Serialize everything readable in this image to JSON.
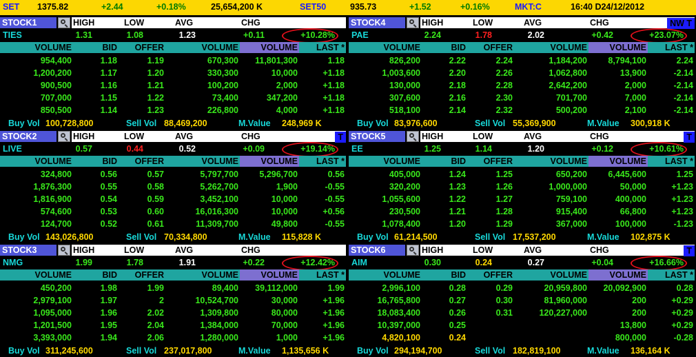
{
  "market_bar": {
    "set_label": "SET",
    "set_index": "1375.82",
    "set_change": "+2.44",
    "set_pct": "+0.18%",
    "set_volume": "25,654,200 K",
    "set50_label": "SET50",
    "set50_index": "935.73",
    "set50_change": "+1.52",
    "set50_pct": "+0.16%",
    "mkt_status": "MKT:C",
    "datetime": "16:40 D24/12/2012"
  },
  "headers": {
    "high": "HIGH",
    "low": "LOW",
    "avg": "AVG",
    "chg": "CHG",
    "volume": "VOLUME",
    "bid": "BID",
    "offer": "OFFER",
    "last": "LAST *",
    "buy_vol": "Buy Vol",
    "sell_vol": "Sell Vol",
    "mvalue": "M.Value"
  },
  "panels": [
    {
      "label": "STOCK1",
      "tag": "",
      "symbol": "TIES",
      "high": "1.31",
      "low": "1.08",
      "avg": "1.23",
      "chg": "+0.11",
      "pct": "+10.28%",
      "low_color": "#39e81b",
      "avg_color": "#ffffff",
      "bids": [
        [
          "954,400",
          "1.18",
          "1.19",
          "670,300"
        ],
        [
          "1,200,200",
          "1.17",
          "1.20",
          "330,300"
        ],
        [
          "900,500",
          "1.16",
          "1.21",
          "100,200"
        ],
        [
          "707,000",
          "1.15",
          "1.22",
          "73,400"
        ],
        [
          "850,500",
          "1.14",
          "1.23",
          "226,800"
        ]
      ],
      "trades": [
        [
          "11,801,300",
          "1.18"
        ],
        [
          "10,000",
          "+1.18"
        ],
        [
          "2,000",
          "+1.18"
        ],
        [
          "347,200",
          "+1.18"
        ],
        [
          "4,000",
          "+1.18"
        ]
      ],
      "buy_vol": "100,728,800",
      "sell_vol": "88,469,200",
      "mvalue": "248,969 K"
    },
    {
      "label": "STOCK4",
      "tag": "NW T",
      "symbol": "PAE",
      "high": "2.24",
      "low": "1.78",
      "avg": "2.02",
      "chg": "+0.42",
      "pct": "+23.07%",
      "low_color": "#ff2020",
      "avg_color": "#ffffff",
      "bids": [
        [
          "826,200",
          "2.22",
          "2.24",
          "1,184,200"
        ],
        [
          "1,003,600",
          "2.20",
          "2.26",
          "1,062,800"
        ],
        [
          "130,000",
          "2.18",
          "2.28",
          "2,642,200"
        ],
        [
          "307,600",
          "2.16",
          "2.30",
          "701,700"
        ],
        [
          "518,100",
          "2.14",
          "2.32",
          "500,200"
        ]
      ],
      "trades": [
        [
          "8,794,100",
          "2.24"
        ],
        [
          "13,900",
          "-2.14"
        ],
        [
          "2,000",
          "-2.14"
        ],
        [
          "7,000",
          "-2.14"
        ],
        [
          "2,100",
          "-2.14"
        ]
      ],
      "buy_vol": "83,976,600",
      "sell_vol": "55,369,900",
      "mvalue": "300,918 K"
    },
    {
      "label": "STOCK2",
      "tag": "T",
      "symbol": "LIVE",
      "high": "0.57",
      "low": "0.44",
      "avg": "0.52",
      "chg": "+0.09",
      "pct": "+19.14%",
      "low_color": "#ff2020",
      "avg_color": "#ffffff",
      "bids": [
        [
          "324,800",
          "0.56",
          "0.57",
          "5,797,700"
        ],
        [
          "1,876,300",
          "0.55",
          "0.58",
          "5,262,700"
        ],
        [
          "1,816,900",
          "0.54",
          "0.59",
          "3,452,100"
        ],
        [
          "574,600",
          "0.53",
          "0.60",
          "16,016,300"
        ],
        [
          "124,700",
          "0.52",
          "0.61",
          "11,309,700"
        ]
      ],
      "trades": [
        [
          "5,296,700",
          "0.56"
        ],
        [
          "1,900",
          "-0.55"
        ],
        [
          "10,000",
          "-0.55"
        ],
        [
          "10,000",
          "+0.56"
        ],
        [
          "49,800",
          "-0.55"
        ]
      ],
      "buy_vol": "143,026,800",
      "sell_vol": "70,334,800",
      "mvalue": "115,828 K"
    },
    {
      "label": "STOCK5",
      "tag": "T",
      "symbol": "EE",
      "high": "1.25",
      "low": "1.14",
      "avg": "1.20",
      "chg": "+0.12",
      "pct": "+10.61%",
      "low_color": "#39e81b",
      "avg_color": "#ffffff",
      "bids": [
        [
          "405,000",
          "1.24",
          "1.25",
          "650,200"
        ],
        [
          "320,200",
          "1.23",
          "1.26",
          "1,000,000"
        ],
        [
          "1,055,600",
          "1.22",
          "1.27",
          "759,100"
        ],
        [
          "230,500",
          "1.21",
          "1.28",
          "915,400"
        ],
        [
          "1,078,400",
          "1.20",
          "1.29",
          "367,000"
        ]
      ],
      "trades": [
        [
          "6,445,600",
          "1.25"
        ],
        [
          "50,000",
          "+1.23"
        ],
        [
          "400,000",
          "+1.23"
        ],
        [
          "66,800",
          "+1.23"
        ],
        [
          "100,000",
          "-1.23"
        ]
      ],
      "buy_vol": "61,214,500",
      "sell_vol": "17,537,200",
      "mvalue": "102,875 K"
    },
    {
      "label": "STOCK3",
      "tag": "",
      "symbol": "NMG",
      "high": "1.99",
      "low": "1.78",
      "avg": "1.91",
      "chg": "+0.22",
      "pct": "+12.42%",
      "low_color": "#39e81b",
      "avg_color": "#ffffff",
      "bids": [
        [
          "450,200",
          "1.98",
          "1.99",
          "89,400"
        ],
        [
          "2,979,100",
          "1.97",
          "2",
          "10,524,700"
        ],
        [
          "1,095,000",
          "1.96",
          "2.02",
          "1,309,800"
        ],
        [
          "1,201,500",
          "1.95",
          "2.04",
          "1,384,000"
        ],
        [
          "3,393,000",
          "1.94",
          "2.06",
          "1,280,000"
        ]
      ],
      "trades": [
        [
          "39,112,000",
          "1.99"
        ],
        [
          "30,000",
          "+1.96"
        ],
        [
          "80,000",
          "+1.96"
        ],
        [
          "70,000",
          "+1.96"
        ],
        [
          "1,000",
          "+1.96"
        ]
      ],
      "buy_vol": "311,245,600",
      "sell_vol": "237,017,800",
      "mvalue": "1,135,656 K"
    },
    {
      "label": "STOCK6",
      "tag": "T",
      "symbol": "AIM",
      "high": "0.30",
      "low": "0.24",
      "avg": "0.27",
      "chg": "+0.04",
      "pct": "+16.66%",
      "low_color": "#ffd800",
      "avg_color": "#ffffff",
      "bids": [
        [
          "2,996,100",
          "0.28",
          "0.29",
          "20,959,800"
        ],
        [
          "16,765,800",
          "0.27",
          "0.30",
          "81,960,000"
        ],
        [
          "18,083,400",
          "0.26",
          "0.31",
          "120,227,000"
        ],
        [
          "10,397,000",
          "0.25",
          "",
          ""
        ],
        [
          "4,820,100",
          "0.24",
          "",
          ""
        ]
      ],
      "trades": [
        [
          "20,092,900",
          "0.28"
        ],
        [
          "200",
          "+0.29"
        ],
        [
          "200",
          "+0.29"
        ],
        [
          "13,800",
          "+0.29"
        ],
        [
          "800,000",
          "-0.28"
        ]
      ],
      "buy_vol": "294,194,700",
      "sell_vol": "182,819,100",
      "mvalue": "136,164 K"
    }
  ]
}
